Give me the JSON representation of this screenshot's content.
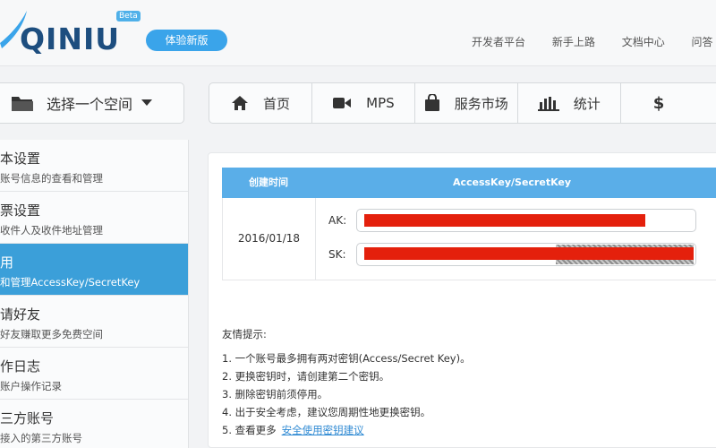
{
  "header": {
    "logo_text": "QINIU",
    "beta_badge": "Beta",
    "trial_button": "体验新版",
    "links": [
      "开发者平台",
      "新手上路",
      "文档中心",
      "问答"
    ]
  },
  "space_selector": {
    "label": "选择一个空间"
  },
  "nav": [
    {
      "label": "首页",
      "icon": "home-icon"
    },
    {
      "label": "MPS",
      "icon": "video-icon"
    },
    {
      "label": "服务市场",
      "icon": "shopping-bag-icon"
    },
    {
      "label": "统计",
      "icon": "bar-chart-icon"
    },
    {
      "label": "$",
      "icon": "dollar-icon"
    }
  ],
  "sidebar": {
    "items": [
      {
        "title": "本设置",
        "sub": "账号信息的查看和管理"
      },
      {
        "title": "票设置",
        "sub": "收件人及收件地址管理"
      },
      {
        "title": "用",
        "sub": "和管理AccessKey/SecretKey"
      },
      {
        "title": "请好友",
        "sub": "好友赚取更多免费空间"
      },
      {
        "title": "作日志",
        "sub": "账户操作记录"
      },
      {
        "title": "三方账号",
        "sub": "接入的第三方账号"
      }
    ]
  },
  "keys_table": {
    "headers": [
      "创建时间",
      "AccessKey/SecretKey"
    ],
    "row": {
      "date": "2016/01/18",
      "ak_label": "AK:",
      "sk_label": "SK:"
    }
  },
  "tips": {
    "title": "友情提示:",
    "items": [
      "1. 一个账号最多拥有两对密钥(Access/Secret Key)。",
      "2. 更换密钥时，请创建第二个密钥。",
      "3. 删除密钥前须停用。",
      "4. 出于安全考虑，建议您周期性地更换密钥。",
      "5. 查看更多"
    ],
    "link": "安全使用密钥建议"
  },
  "colors": {
    "accent": "#3b9fd9",
    "header_blue": "#5aaee8",
    "redaction": "#e4200c"
  }
}
